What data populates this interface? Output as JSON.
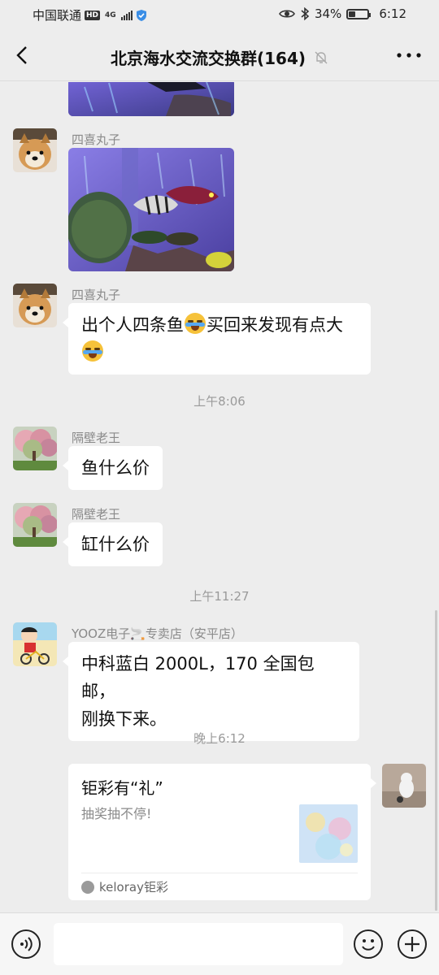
{
  "status_bar": {
    "carrier": "中国联通",
    "hd_badge": "HD",
    "network_badge": "4G",
    "battery_percent_text": "34%",
    "battery_level": 0.34,
    "time": "6:12"
  },
  "header": {
    "title": "北京海水交流交换群(164)",
    "back_icon": "chevron-left-icon",
    "mute_icon": "bell-off-icon",
    "more_icon": "more-dots-icon"
  },
  "messages": [
    {
      "sender": "四喜丸子",
      "type": "image"
    },
    {
      "sender": "四喜丸子",
      "type": "text",
      "text_1": "出个人四条鱼",
      "text_2": "买回来发现有点大",
      "emoji": "crying-laughing-emoji"
    },
    {
      "timestamp": "上午8:06"
    },
    {
      "sender": "隔壁老王",
      "type": "text",
      "text": "鱼什么价"
    },
    {
      "sender": "隔壁老王",
      "type": "text",
      "text": "缸什么价"
    },
    {
      "timestamp": "上午11:27"
    },
    {
      "sender": "YOOZ电子🚬专卖店（安平店）",
      "type": "text",
      "line_1": "中科蓝白 2000L，170 全国包邮，",
      "line_2": "刚换下来。"
    },
    {
      "timestamp": "晚上6:12"
    },
    {
      "type": "card",
      "title": "钜彩有“礼”",
      "description": "抽奖抽不停!",
      "source": "keloray钜彩"
    }
  ],
  "input_bar": {
    "voice_icon": "voice-icon",
    "emoji_icon": "emoji-icon",
    "add_icon": "plus-icon",
    "input_value": ""
  }
}
